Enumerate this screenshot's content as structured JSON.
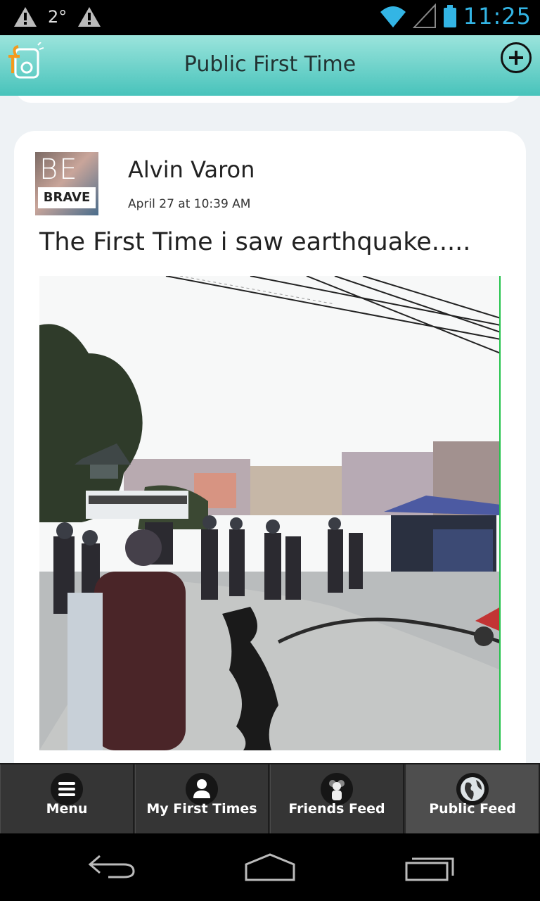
{
  "status_bar": {
    "temperature": "2°",
    "time": "11:25",
    "icons": [
      "warning-icon",
      "warning-icon",
      "wifi-icon",
      "signal-icon",
      "battery-icon"
    ]
  },
  "header": {
    "title": "Public First Time",
    "logo_icon": "app-logo-icon",
    "add_icon": "plus-circle-icon"
  },
  "post": {
    "avatar_text_top": "BE",
    "avatar_text_bottom": "BRAVE",
    "author": "Alvin Varon",
    "timestamp": "April 27 at 10:39 AM",
    "title": "The First Time i saw earthquake.....",
    "image_icon": "post-photo"
  },
  "bottom_nav": {
    "items": [
      {
        "label": "Menu",
        "icon": "menu-icon"
      },
      {
        "label": "My First Times",
        "icon": "user-icon"
      },
      {
        "label": "Friends Feed",
        "icon": "friends-icon"
      },
      {
        "label": "Public Feed",
        "icon": "globe-icon"
      }
    ],
    "active_index": 3
  },
  "system_nav": {
    "buttons": [
      "back-icon",
      "home-icon",
      "recents-icon"
    ]
  },
  "colors": {
    "header_top": "#9be4dc",
    "header_bottom": "#48c3bb",
    "status_accent": "#33b5e5",
    "logo_orange": "#f39a1e"
  }
}
